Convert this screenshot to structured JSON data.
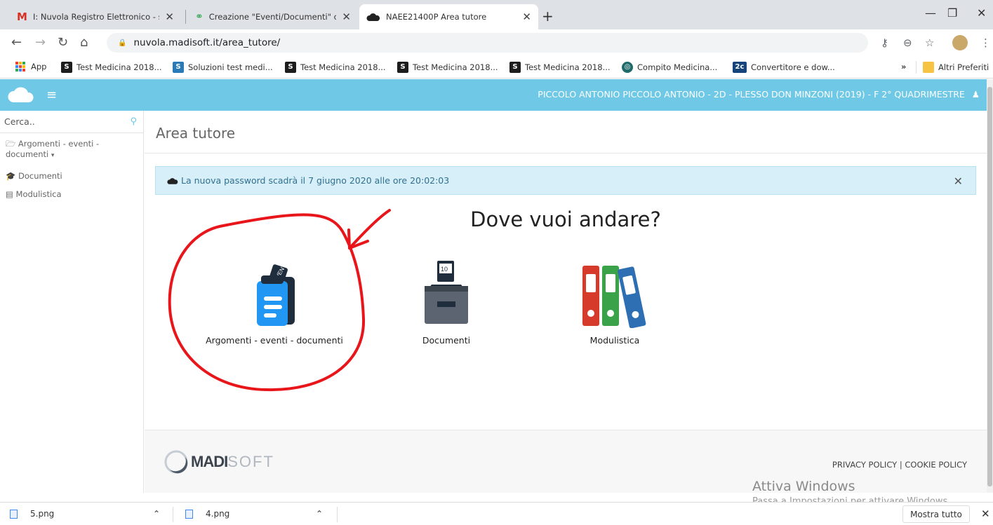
{
  "browser": {
    "tabs": [
      {
        "label": "I: Nuvola Registro Elettronico - st"
      },
      {
        "label": "Creazione \"Eventi/Documenti\" cla"
      },
      {
        "label": "NAEE21400P Area tutore"
      }
    ],
    "url": "nuvola.madisoft.it/area_tutore/",
    "bookmarks": [
      {
        "label": "App"
      },
      {
        "label": "Test Medicina 2018..."
      },
      {
        "label": "Soluzioni test medi..."
      },
      {
        "label": "Test Medicina 2018..."
      },
      {
        "label": "Test Medicina 2018..."
      },
      {
        "label": "Test Medicina 2018..."
      },
      {
        "label": "Compito Medicina..."
      },
      {
        "label": "Convertitore e dow..."
      }
    ],
    "bookmark_overflow": "»",
    "other_bookmarks": "Altri Preferiti"
  },
  "header": {
    "user_info": "PICCOLO ANTONIO  PICCOLO ANTONIO - 2D - PLESSO DON MINZONI (2019) - F  2° QUADRIMESTRE"
  },
  "sidebar": {
    "search_placeholder": "Cerca..",
    "items": [
      {
        "label": "Argomenti - eventi - documenti",
        "caret": "▾"
      },
      {
        "label": "Documenti"
      },
      {
        "label": "Modulistica"
      }
    ]
  },
  "main": {
    "title": "Area tutore",
    "alert": "La nuova password scadrà il 7 giugno 2020 alle ore 20:02:03",
    "heading": "Dove vuoi andare?",
    "cards": [
      {
        "label": "Argomenti - eventi - documenti"
      },
      {
        "label": "Documenti"
      },
      {
        "label": "Modulistica"
      }
    ]
  },
  "footer": {
    "brand_bold": "MADI",
    "brand_light": "SOFT",
    "links": "PRIVACY POLICY | COOKIE POLICY"
  },
  "watermark": {
    "line1": "Attiva Windows",
    "line2": "Passa a Impostazioni per attivare Windows."
  },
  "downloads": {
    "files": [
      {
        "name": "5.png"
      },
      {
        "name": "4.png"
      }
    ],
    "show_all": "Mostra tutto"
  },
  "colors": {
    "header": "#6ec8e6",
    "alert_bg": "#d6eff8",
    "annotation": "#e8161b"
  }
}
